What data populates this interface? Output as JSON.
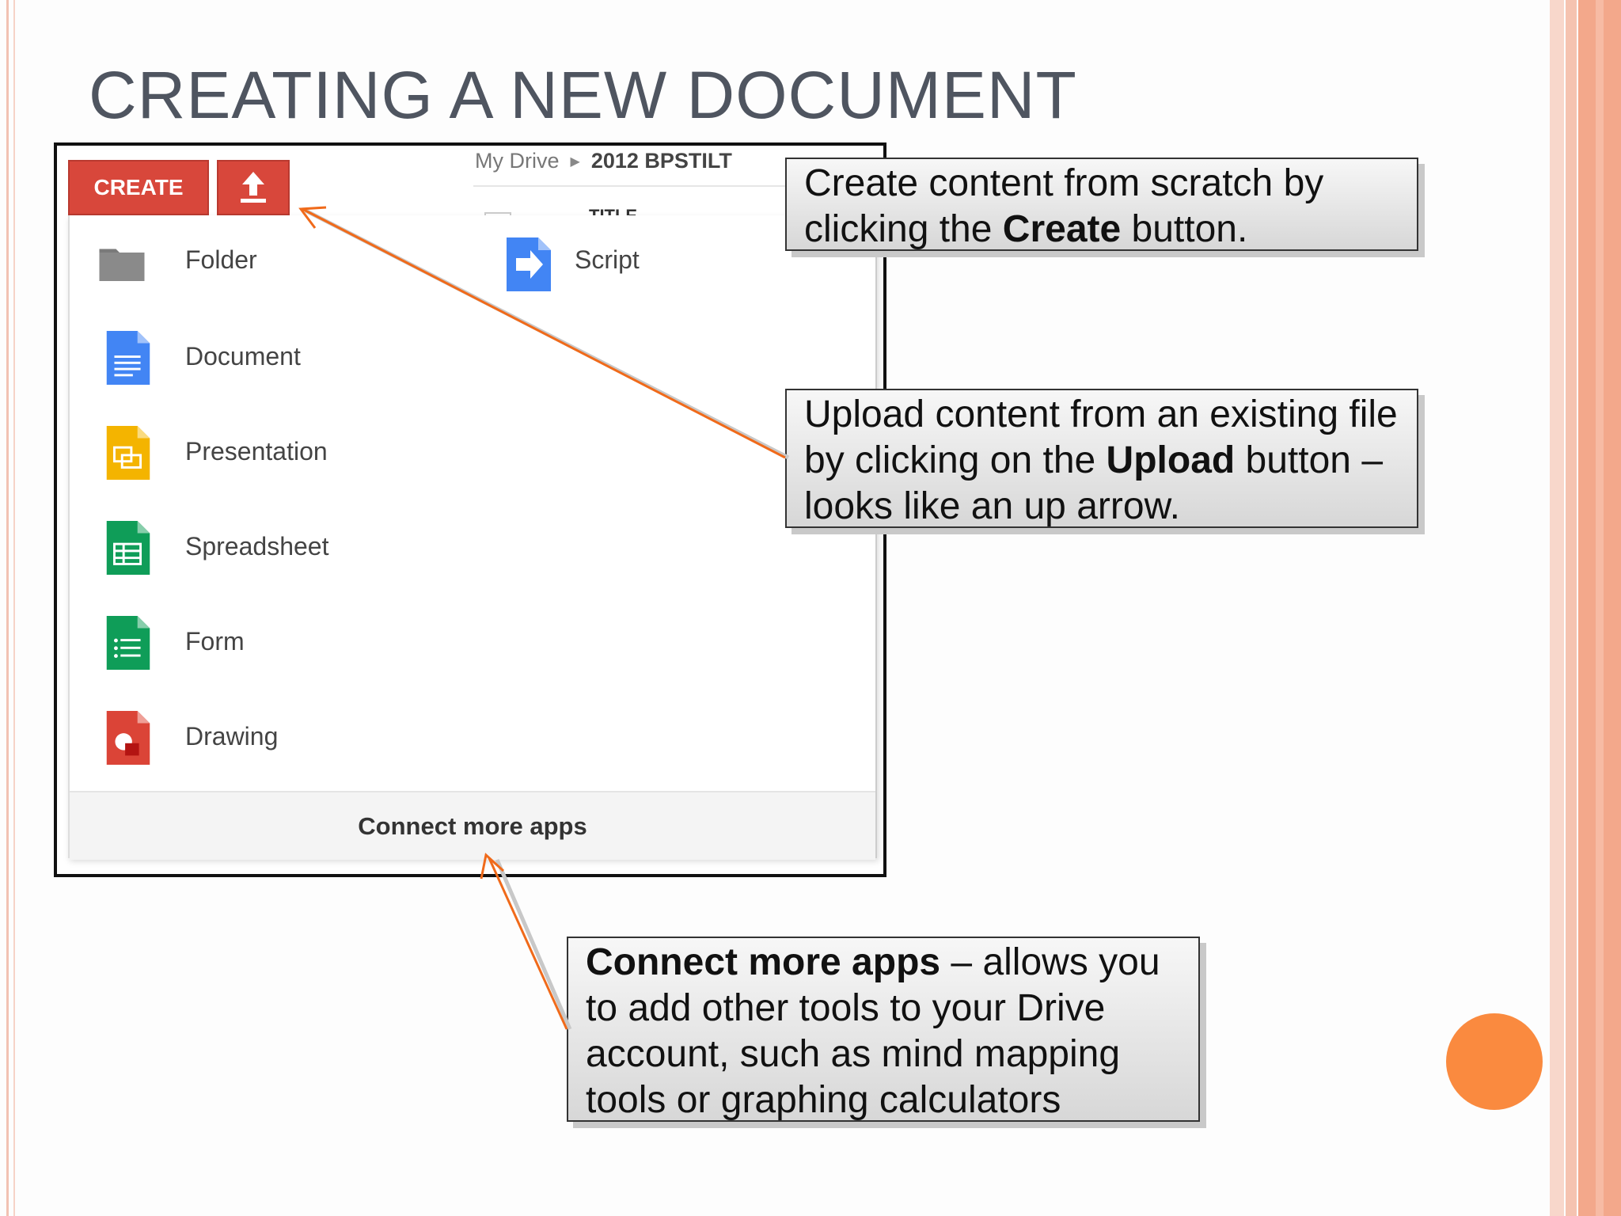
{
  "slide": {
    "title": "CREATING A NEW DOCUMENT"
  },
  "drive": {
    "breadcrumb": [
      "My Drive",
      "2012 BPSTILT"
    ],
    "column_header": "TITLE",
    "create_label": "CREATE",
    "upload_icon": "upload-arrow-icon",
    "menu_items": [
      {
        "label": "Folder",
        "icon": "folder-icon",
        "color": "#7a7a7a"
      },
      {
        "label": "Script",
        "icon": "script-icon",
        "color": "#4285f4"
      },
      {
        "label": "Document",
        "icon": "document-icon",
        "color": "#4285f4"
      },
      {
        "label": "Presentation",
        "icon": "presentation-icon",
        "color": "#f4b400"
      },
      {
        "label": "Spreadsheet",
        "icon": "spreadsheet-icon",
        "color": "#0f9d58"
      },
      {
        "label": "Form",
        "icon": "form-icon",
        "color": "#0f9d58"
      },
      {
        "label": "Drawing",
        "icon": "drawing-icon",
        "color": "#db4437"
      }
    ],
    "connect_label": "Connect more apps"
  },
  "callouts": {
    "create": {
      "pre": "Create content from scratch by clicking the ",
      "bold": "Create",
      "post": " button."
    },
    "upload": {
      "pre": "Upload content from an existing file by clicking on the ",
      "bold": "Upload",
      "post": " button – looks like an up arrow."
    },
    "connect": {
      "bold": "Connect more apps",
      "post": " – allows you to add other tools to your Drive account, such as mind mapping tools or graphing calculators"
    }
  },
  "colors": {
    "create_button": "#d8473b",
    "accent_orange": "#fa8a3f",
    "arrow": "#f06a1a"
  }
}
